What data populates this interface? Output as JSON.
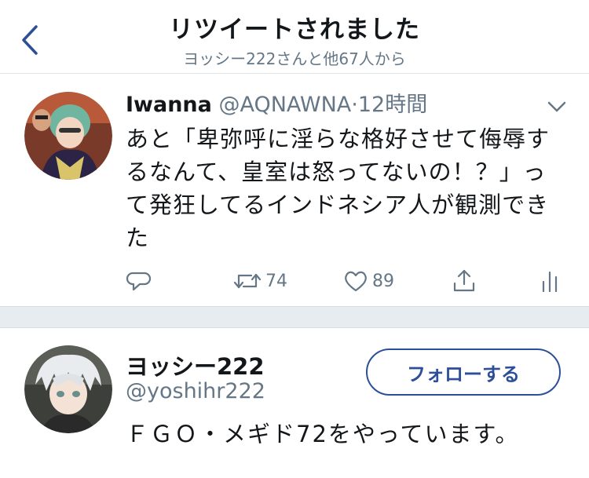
{
  "header": {
    "title": "リツイートされました",
    "subtitle": "ヨッシー222さんと他67人から"
  },
  "tweet": {
    "display_name": "Iwanna",
    "handle": "@AQNAWNA",
    "separator": "·",
    "time": "12時間",
    "text": "あと「卑弥呼に淫らな格好させて侮辱するなんて、皇室は怒ってないの！？」って発狂してるインドネシア人が観測できた",
    "actions": {
      "reply_icon": "reply-icon",
      "retweet_icon": "retweet-icon",
      "retweet_count": "74",
      "like_icon": "heart-icon",
      "like_count": "89",
      "share_icon": "share-icon",
      "stats_icon": "stats-icon"
    }
  },
  "user": {
    "name": "ヨッシー222",
    "handle": "@yoshihr222",
    "bio": "ＦＧＯ・メギド72をやっています。",
    "follow_label": "フォローする"
  },
  "colors": {
    "accent": "#2d4f9a",
    "text": "#14171a",
    "muted": "#657786",
    "separator": "#e6ecf0"
  }
}
